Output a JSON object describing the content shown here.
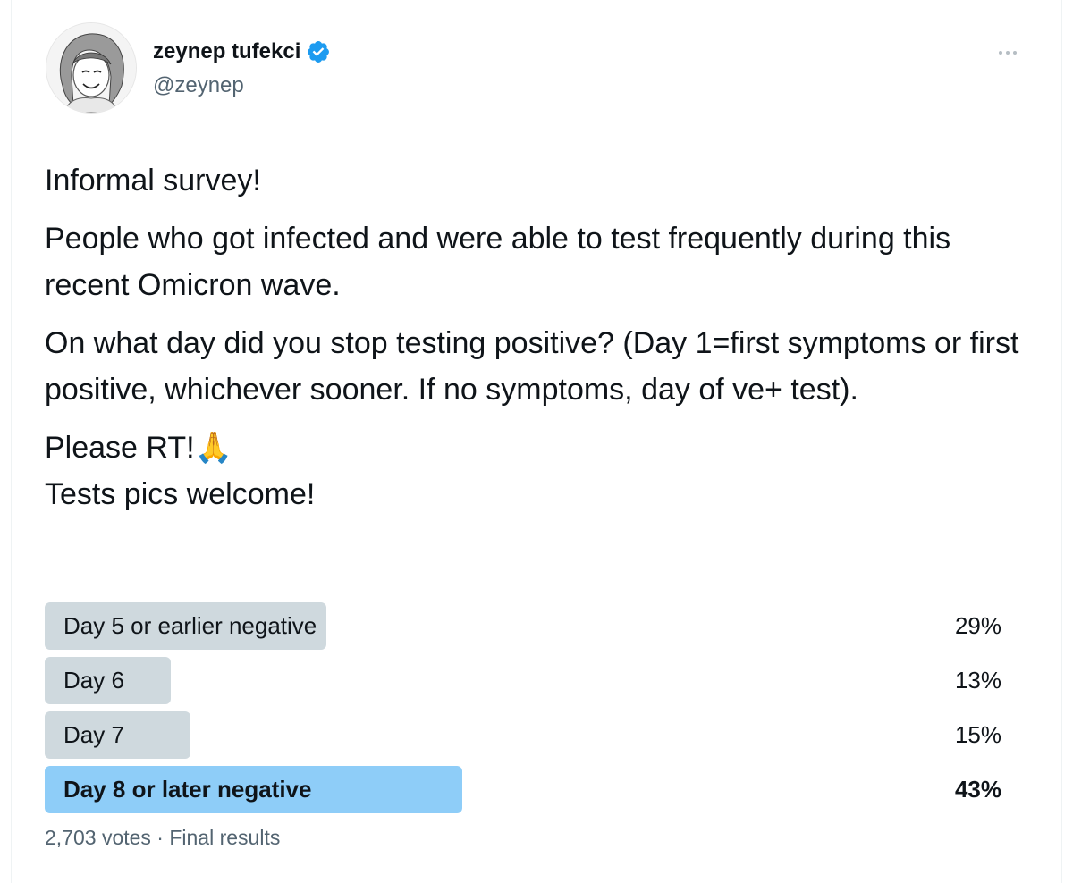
{
  "tweet": {
    "author": {
      "name": "zeynep tufekci",
      "handle": "@zeynep",
      "verified": true,
      "avatar_icon": "user-avatar-sketch"
    },
    "more_icon": "more-dots-icon",
    "paragraphs": [
      "Informal survey!",
      "People who got infected and were able to test frequently during this recent Omicron wave.",
      "On what day did you stop testing positive? (Day 1=first symptoms or first positive, whichever sooner. If no symptoms, day of ve+ test).",
      "Please RT!🙏",
      "Tests pics welcome!"
    ],
    "poll": {
      "options": [
        {
          "label": "Day 5 or earlier negative",
          "percent_text": "29%",
          "percent": 29,
          "winner": false
        },
        {
          "label": "Day 6",
          "percent_text": "13%",
          "percent": 13,
          "winner": false
        },
        {
          "label": "Day 7",
          "percent_text": "15%",
          "percent": 15,
          "winner": false
        },
        {
          "label": "Day 8 or later negative",
          "percent_text": "43%",
          "percent": 43,
          "winner": true
        }
      ],
      "footer": "2,703 votes · Final results"
    }
  },
  "colors": {
    "bar": "#cfd9de",
    "winner_bar": "#8ecdf8",
    "verified_badge": "#1d9bf0",
    "secondary_text": "#536471"
  }
}
